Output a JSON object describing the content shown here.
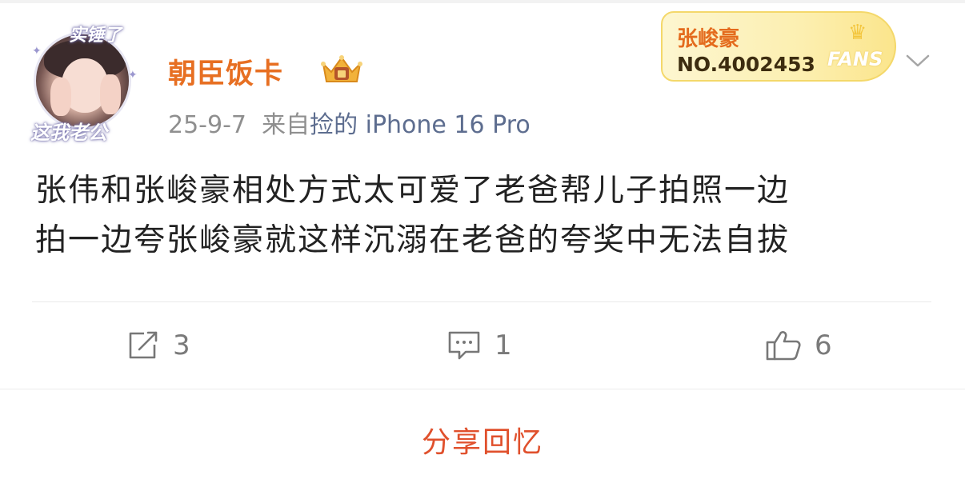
{
  "post": {
    "username": "朝臣饭卡",
    "date": "25-9-7",
    "source_prefix": "来自",
    "source_device": "捡的 iPhone 16 Pro",
    "content_line1": "张伟和张峻豪相处方式太可爱了老爸帮儿子拍照一边",
    "content_line2": "拍一边夸张峻豪就这样沉溺在老爸的夸奖中无法自拔"
  },
  "avatar": {
    "top_text": "实锤了",
    "bottom_text": "这我老公"
  },
  "fan_badge": {
    "star_name": "张峻豪",
    "fan_number": "NO.4002453",
    "fans_label": "FANS"
  },
  "actions": {
    "repost_count": "3",
    "comment_count": "1",
    "like_count": "6"
  },
  "footer": {
    "share_label": "分享回忆"
  },
  "icons": [
    "crown-icon",
    "chevron-down-icon",
    "repost-icon",
    "comment-icon",
    "like-icon"
  ],
  "colors": {
    "username": "#e76f22",
    "share": "#e0502c",
    "meta": "#8f8f8f",
    "badge_bg": "#fcefb0"
  }
}
